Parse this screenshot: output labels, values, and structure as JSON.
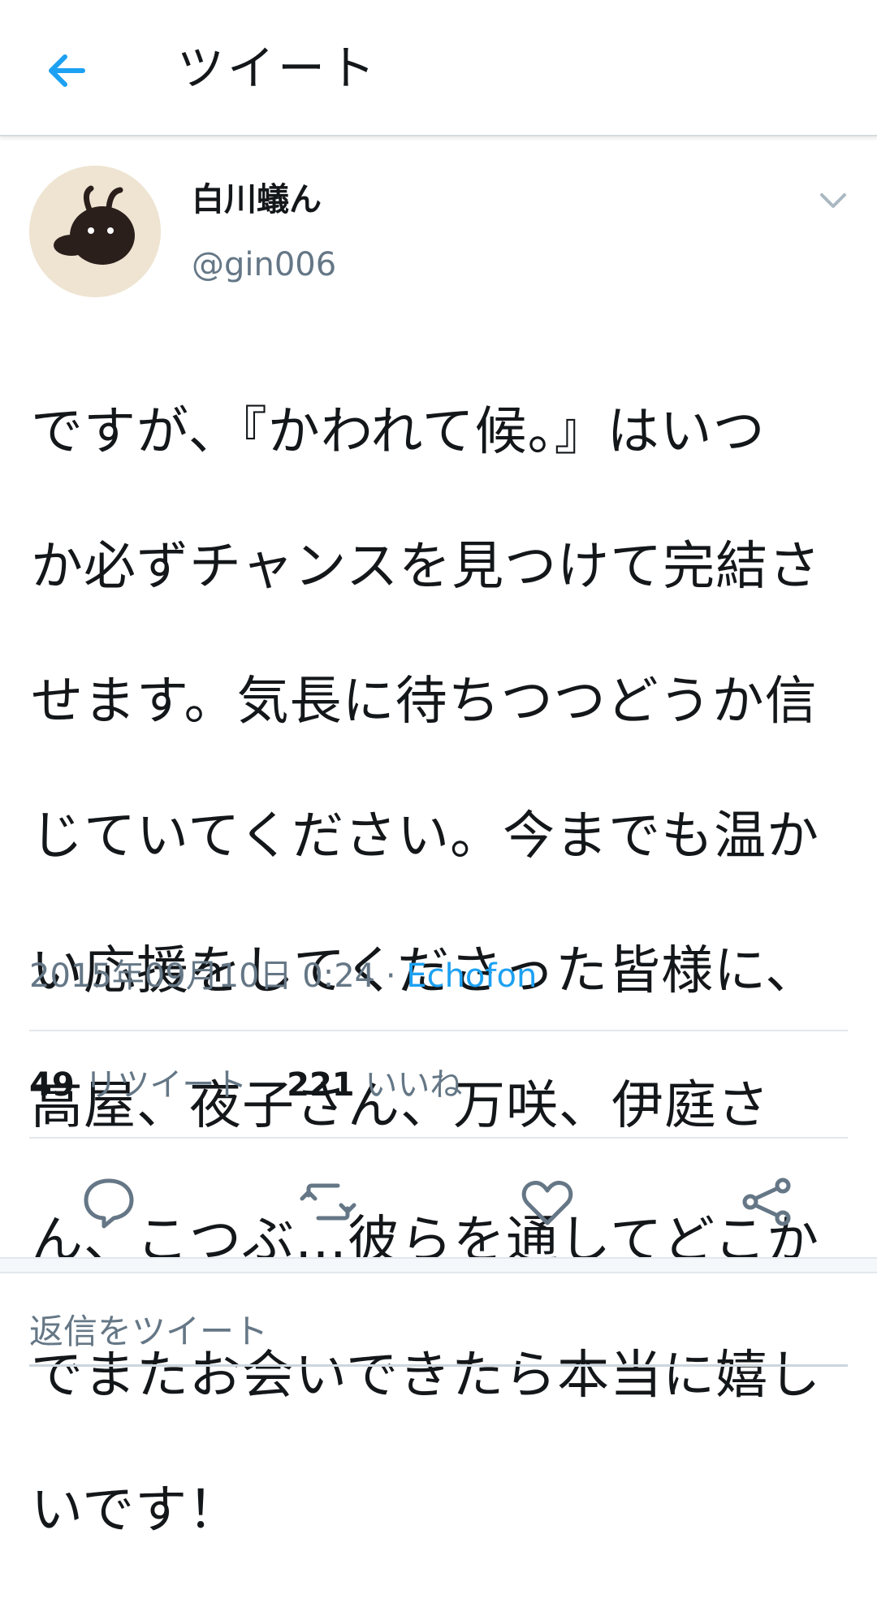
{
  "header": {
    "title": "ツイート",
    "back_icon": "arrow-left-icon"
  },
  "user": {
    "display_name": "白川蟻ん",
    "handle": "@gin006",
    "avatar_icon": "ant-avatar-icon"
  },
  "tweet": {
    "text": "ですが、『かわれて候。』はいつか必ずチャンスを見つけて完結させます。気長に待ちつつどうか信じていてください。今までも温かい応援をしてくださった皆様に、高屋、夜子さん、万咲、伊庭さん、こつぶ…彼らを通してどこかでまたお会いできたら本当に嬉しいです！",
    "lines": [
      "ですが、『かわれて候。』はいつ",
      "か必ずチャンスを見つけて完結さ",
      "せます。気長に待ちつつどうか信",
      "じていてください。今までも温か",
      "い応援をしてくださった皆様に、",
      "高屋、夜子さん、万咲、伊庭さ",
      "ん、こつぶ…彼らを通してどこか",
      "でまたお会いできたら本当に嬉し",
      "いです！"
    ],
    "timestamp": "2015年09月10日 0:24",
    "separator": "·",
    "source": "Echofon"
  },
  "stats": {
    "retweet_count": "49",
    "retweet_label": "リツイート",
    "like_count": "221",
    "like_label": "いいね"
  },
  "actions": {
    "reply_icon": "reply-icon",
    "retweet_icon": "retweet-icon",
    "like_icon": "heart-icon",
    "share_icon": "share-icon"
  },
  "reply": {
    "placeholder": "返信をツイート"
  },
  "colors": {
    "accent": "#1da1f2",
    "secondary_text": "#657786",
    "icon_gray": "#657786",
    "divider": "#e1e8ed"
  }
}
